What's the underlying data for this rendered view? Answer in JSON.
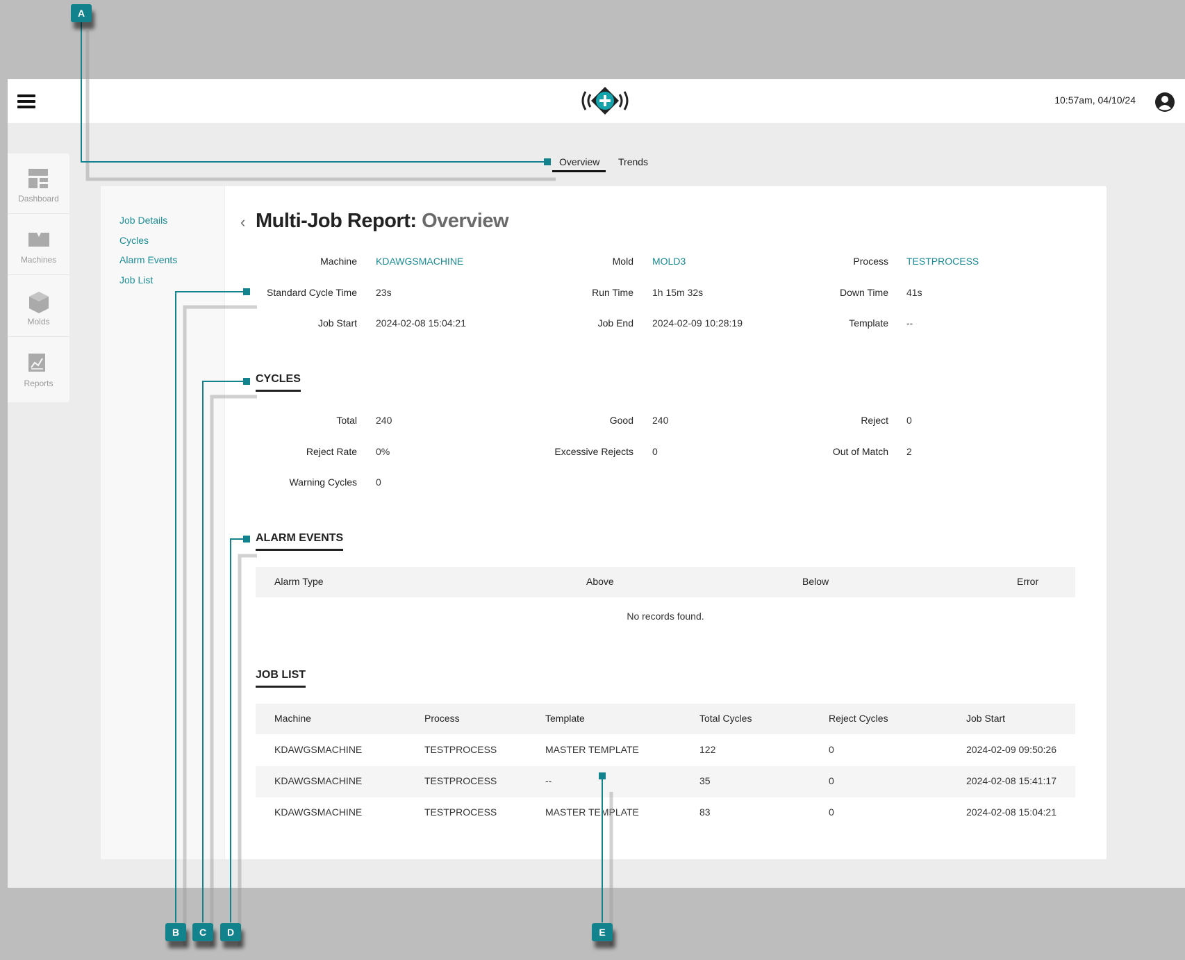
{
  "header": {
    "clock": "10:57am, 04/10/24"
  },
  "sidebar": {
    "items": [
      {
        "label": "Dashboard",
        "icon": "dashboard-icon"
      },
      {
        "label": "Machines",
        "icon": "machines-icon"
      },
      {
        "label": "Molds",
        "icon": "molds-icon"
      },
      {
        "label": "Reports",
        "icon": "reports-icon"
      }
    ]
  },
  "tabs": [
    "Overview",
    "Trends"
  ],
  "left_nav": [
    "Job Details",
    "Cycles",
    "Alarm Events",
    "Job List"
  ],
  "page": {
    "title": "Multi-Job Report:",
    "subtitle": "Overview"
  },
  "job_details": {
    "machine_label": "Machine",
    "machine": "KDAWGSMACHINE",
    "mold_label": "Mold",
    "mold": "MOLD3",
    "process_label": "Process",
    "process": "TESTPROCESS",
    "std_cycle_label": "Standard Cycle Time",
    "std_cycle": "23s",
    "run_time_label": "Run Time",
    "run_time": "1h 15m 32s",
    "down_time_label": "Down Time",
    "down_time": "41s",
    "job_start_label": "Job Start",
    "job_start": "2024-02-08 15:04:21",
    "job_end_label": "Job End",
    "job_end": "2024-02-09 10:28:19",
    "template_label": "Template",
    "template": "--"
  },
  "cycles": {
    "heading": "CYCLES",
    "total_label": "Total",
    "total": "240",
    "good_label": "Good",
    "good": "240",
    "reject_label": "Reject",
    "reject": "0",
    "reject_rate_label": "Reject Rate",
    "reject_rate": "0%",
    "excessive_label": "Excessive Rejects",
    "excessive": "0",
    "out_of_match_label": "Out of Match",
    "out_of_match": "2",
    "warning_label": "Warning Cycles",
    "warning": "0"
  },
  "alarm_events": {
    "heading": "ALARM EVENTS",
    "columns": [
      "Alarm Type",
      "Above",
      "Below",
      "Error"
    ],
    "empty": "No records found."
  },
  "job_list": {
    "heading": "JOB LIST",
    "columns": [
      "Machine",
      "Process",
      "Template",
      "Total Cycles",
      "Reject Cycles",
      "Job Start"
    ],
    "rows": [
      [
        "KDAWGSMACHINE",
        "TESTPROCESS",
        "MASTER TEMPLATE",
        "122",
        "0",
        "2024-02-09 09:50:26"
      ],
      [
        "KDAWGSMACHINE",
        "TESTPROCESS",
        "--",
        "35",
        "0",
        "2024-02-08 15:41:17"
      ],
      [
        "KDAWGSMACHINE",
        "TESTPROCESS",
        "MASTER TEMPLATE",
        "83",
        "0",
        "2024-02-08 15:04:21"
      ]
    ]
  },
  "callouts": [
    "A",
    "B",
    "C",
    "D",
    "E"
  ],
  "colors": {
    "accent": "#1a8c94",
    "callout": "#12838c",
    "frame": "#bdbdbd"
  }
}
